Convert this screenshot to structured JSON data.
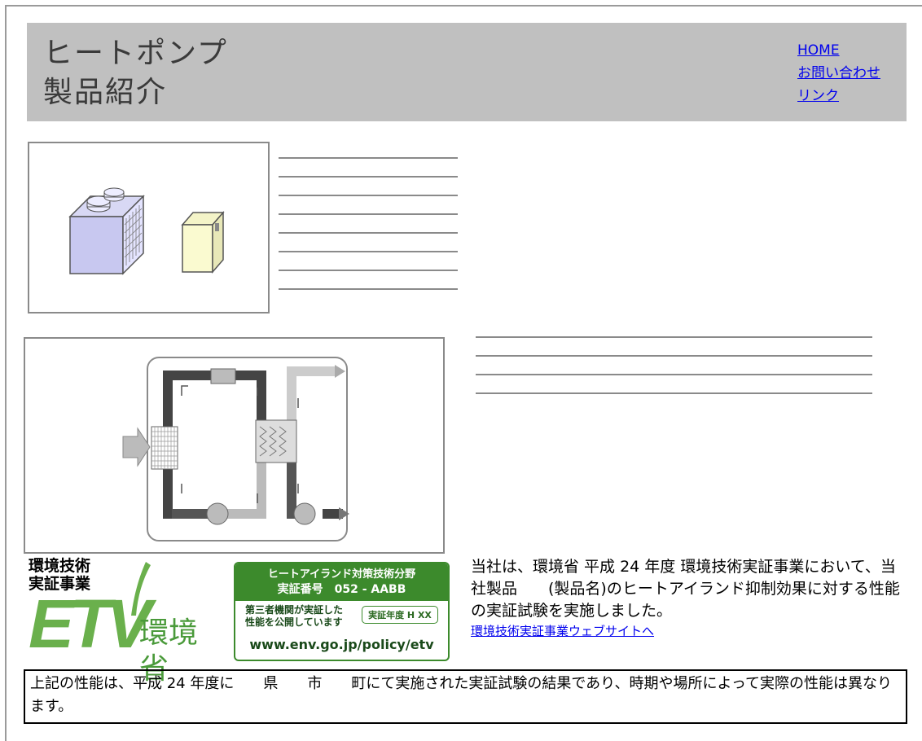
{
  "header": {
    "title_line1": "ヒートポンプ",
    "title_line2": "製品紹介",
    "nav": [
      "HOME",
      "お問い合わせ",
      "リンク"
    ]
  },
  "etv_logo": {
    "line1": "環境技術",
    "line2": "実証事業",
    "mark": "ETV",
    "ministry": "環境省"
  },
  "certificate": {
    "category": "ヒートアイランド対策技術分野",
    "number": "実証番号　052 - AABB",
    "text_line1": "第三者機関が実証した",
    "text_line2": "性能を公開しています",
    "year": "実証年度 H XX",
    "url": "www.env.go.jp/policy/etv"
  },
  "description": {
    "text": "当社は、環境省 平成 24 年度 環境技術実証事業において、当社製品　　(製品名)のヒートアイランド抑制効果に対する性能の実証試験を実施しました。",
    "link": "環境技術実証事業ウェブサイトへ"
  },
  "note": {
    "text": "上記の性能は、平成 24 年度に　　県　　市　　町にて実施された実証試験の結果であり、時期や場所によって実際の性能は異なります。"
  },
  "colors": {
    "header_bg": "#c0c0c0",
    "etv_green": "#6ab04c",
    "cert_green": "#3c8a2c",
    "link": "#0000ee"
  }
}
